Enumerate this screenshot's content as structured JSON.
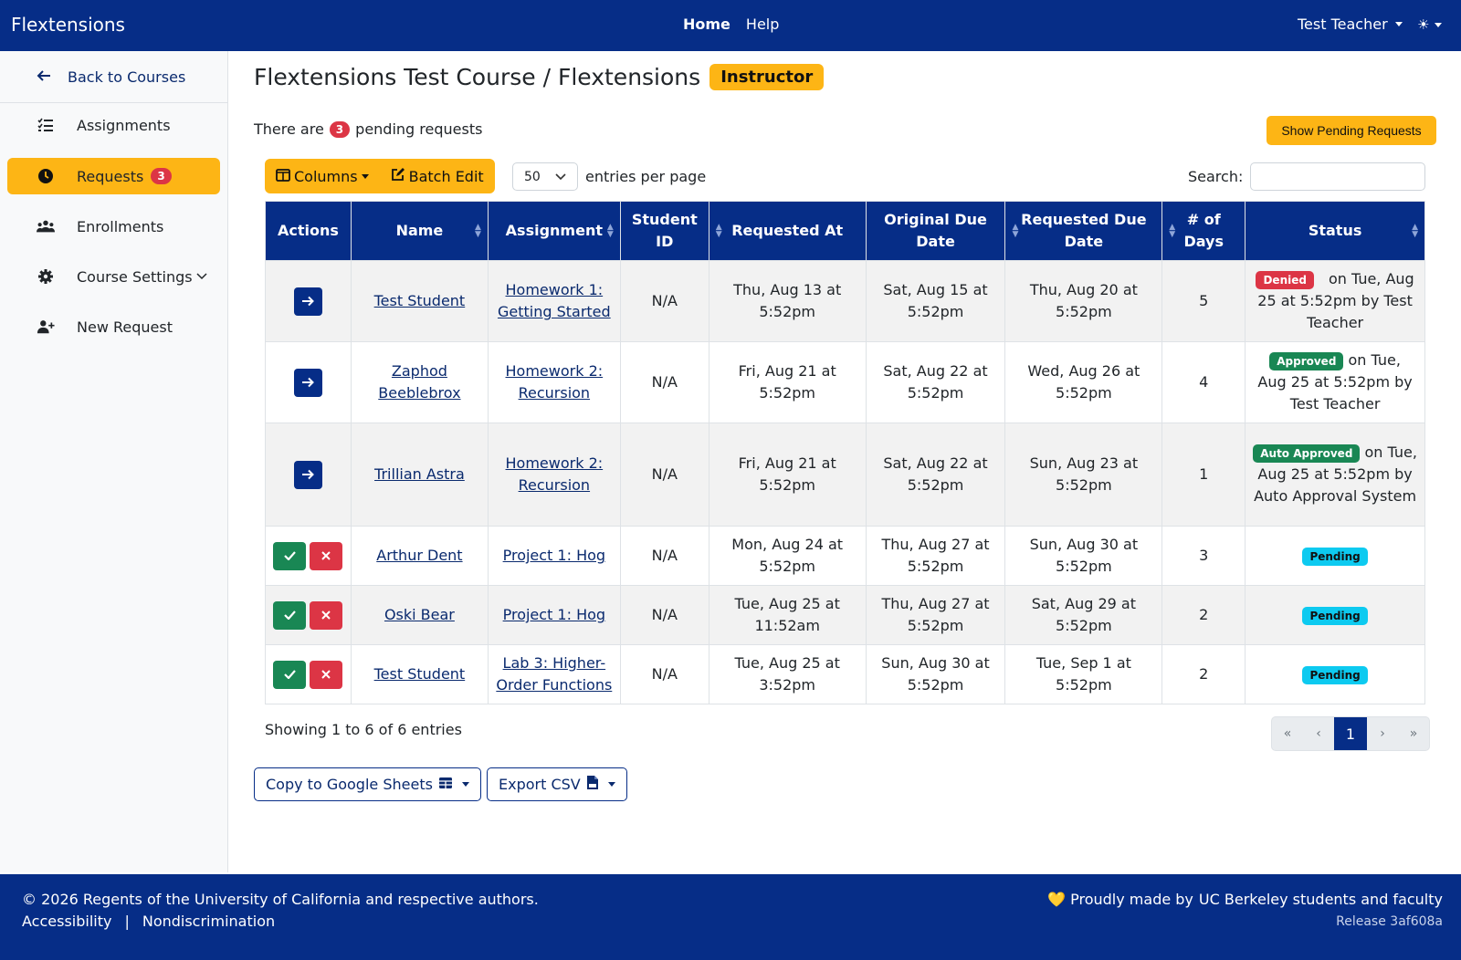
{
  "nav": {
    "brand": "Flextensions",
    "home": "Home",
    "help": "Help",
    "user": "Test Teacher",
    "theme_icon": "☀"
  },
  "sidebar": {
    "back": "Back to Courses",
    "items": [
      {
        "label": "Assignments"
      },
      {
        "label": "Requests",
        "badge": "3"
      },
      {
        "label": "Enrollments"
      },
      {
        "label": "Course Settings"
      },
      {
        "label": "New Request"
      }
    ]
  },
  "page": {
    "title": "Flextensions Test Course / Flextensions",
    "role": "Instructor",
    "pending_prefix": "There are",
    "pending_count": "3",
    "pending_suffix": "pending requests",
    "show_pending": "Show Pending Requests"
  },
  "toolbar": {
    "columns": "Columns",
    "batch_edit": "Batch Edit",
    "per_page": "50",
    "per_page_label": "entries per page",
    "search_label": "Search:"
  },
  "table": {
    "headers": [
      "Actions",
      "Name",
      "Assignment",
      "Student ID",
      "Requested At",
      "Original Due Date",
      "Requested Due Date",
      "# of Days",
      "Status"
    ],
    "rows": [
      {
        "name": "Test Student",
        "assignment": "Homework 1: Getting Started",
        "sid": "N/A",
        "requested_at": "Thu, Aug 13 at 5:52pm",
        "original": "Sat, Aug 15 at 5:52pm",
        "requested_due": "Thu, Aug 20 at 5:52pm",
        "days": "5",
        "status": "Denied",
        "status_text": "on Tue, Aug 25 at 5:52pm by Test Teacher"
      },
      {
        "name": "Zaphod Beeblebrox",
        "assignment": "Homework 2: Recursion",
        "sid": "N/A",
        "requested_at": "Fri, Aug 21 at 5:52pm",
        "original": "Sat, Aug 22 at 5:52pm",
        "requested_due": "Wed, Aug 26 at 5:52pm",
        "days": "4",
        "status": "Approved",
        "status_text": "on Tue, Aug 25 at 5:52pm by Test Teacher"
      },
      {
        "name": "Trillian Astra",
        "assignment": "Homework 2: Recursion",
        "sid": "N/A",
        "requested_at": "Fri, Aug 21 at 5:52pm",
        "original": "Sat, Aug 22 at 5:52pm",
        "requested_due": "Sun, Aug 23 at 5:52pm",
        "days": "1",
        "status": "Auto Approved",
        "status_text": "on Tue, Aug 25 at 5:52pm by Auto Approval System"
      },
      {
        "name": "Arthur Dent",
        "assignment": "Project 1: Hog",
        "sid": "N/A",
        "requested_at": "Mon, Aug 24 at 5:52pm",
        "original": "Thu, Aug 27 at 5:52pm",
        "requested_due": "Sun, Aug 30 at 5:52pm",
        "days": "3",
        "status": "Pending",
        "status_text": ""
      },
      {
        "name": "Oski Bear",
        "assignment": "Project 1: Hog",
        "sid": "N/A",
        "requested_at": "Tue, Aug 25 at 11:52am",
        "original": "Thu, Aug 27 at 5:52pm",
        "requested_due": "Sat, Aug 29 at 5:52pm",
        "days": "2",
        "status": "Pending",
        "status_text": ""
      },
      {
        "name": "Test Student",
        "assignment": "Lab 3: Higher-Order Functions",
        "sid": "N/A",
        "requested_at": "Tue, Aug 25 at 3:52pm",
        "original": "Sun, Aug 30 at 5:52pm",
        "requested_due": "Tue, Sep 1 at 5:52pm",
        "days": "2",
        "status": "Pending",
        "status_text": ""
      }
    ]
  },
  "pagination": {
    "showing": "Showing 1 to 6 of 6 entries",
    "first": "«",
    "prev": "‹",
    "current": "1",
    "next": "›",
    "last": "»"
  },
  "export": {
    "google": "Copy to Google Sheets",
    "csv": "Export CSV"
  },
  "footer": {
    "copyright": "© 2026 Regents of the University of California and respective authors.",
    "accessibility": "Accessibility",
    "separator": "|",
    "nondiscrimination": "Nondiscrimination",
    "made_by": "💛 Proudly made by",
    "made_by_link": "UC Berkeley students and faculty",
    "release_label": "Release",
    "release": "3af608a"
  },
  "colors": {
    "navy": "#062d87",
    "gold": "#fdb515",
    "danger": "#dc3545",
    "success": "#198754",
    "info": "#0dcaf0"
  }
}
